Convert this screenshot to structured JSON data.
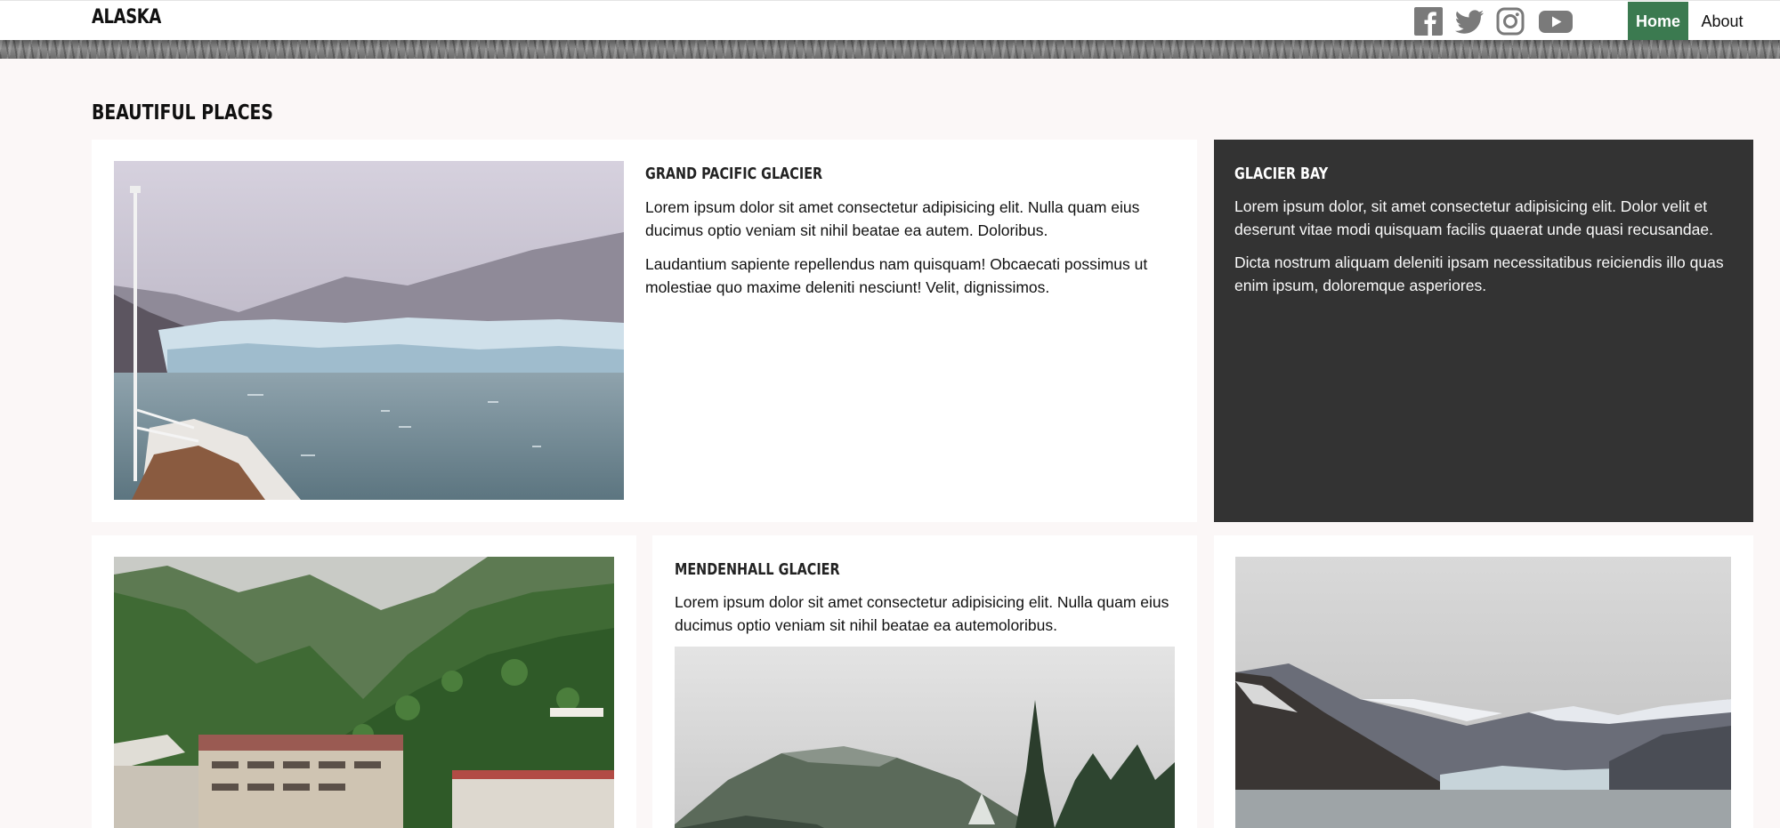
{
  "header": {
    "brand": "ALASKA",
    "social": [
      "facebook-icon",
      "twitter-icon",
      "instagram-icon",
      "youtube-icon"
    ],
    "nav": {
      "home": "Home",
      "about": "About"
    },
    "accent_color": "#3b7a50"
  },
  "section": {
    "title": "BEAUTIFUL PLACES"
  },
  "cards": {
    "grand_pacific": {
      "title": "GRAND PACIFIC GLACIER",
      "p1": "Lorem ipsum dolor sit amet consectetur adipisicing elit. Nulla quam eius ducimus optio veniam sit nihil beatae ea autem. Doloribus.",
      "p2": "Laudantium sapiente repellendus nam quisquam! Obcaecati possimus ut molestiae quo maxime deleniti nesciunt! Velit, dignissimos."
    },
    "glacier_bay": {
      "title": "GLACIER BAY",
      "p1": "Lorem ipsum dolor, sit amet consectetur adipisicing elit. Dolor velit et deserunt vitae modi quisquam facilis quaerat unde quasi recusandae.",
      "p2": "Dicta nostrum aliquam deleniti ipsam necessitatibus reiciendis illo quas enim ipsum, doloremque asperiores."
    },
    "mendenhall": {
      "title": "MENDENHALL GLACIER",
      "p1": "Lorem ipsum dolor sit amet consectetur adipisicing elit. Nulla quam eius ducimus optio veniam sit nihil beatae ea autemoloribus."
    }
  },
  "colors": {
    "page_bg": "#fbf7f7",
    "dark_card": "#333333"
  }
}
